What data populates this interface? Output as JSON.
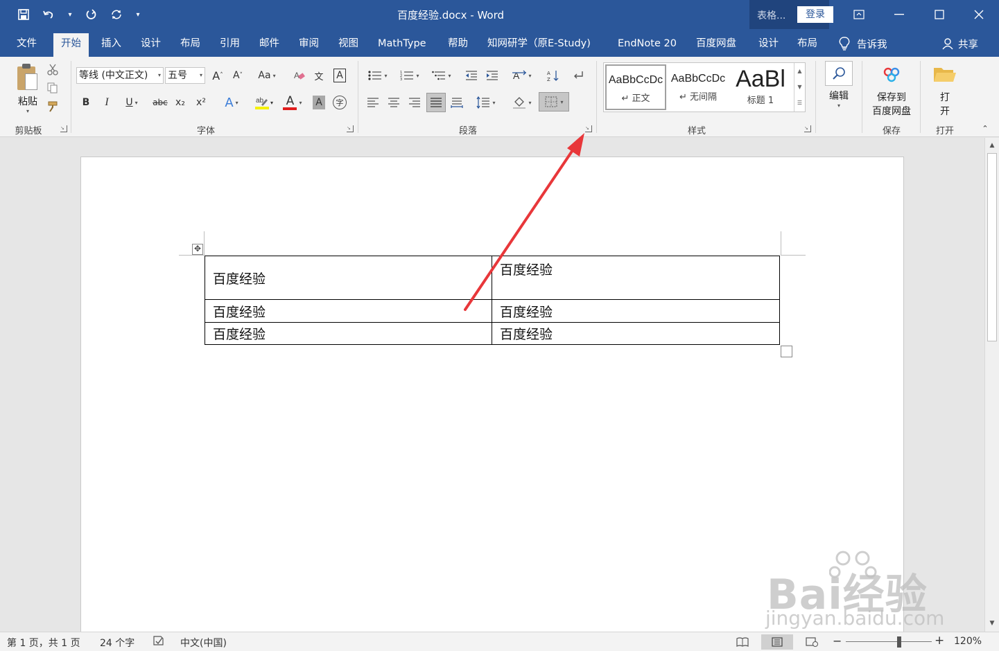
{
  "titlebar": {
    "document_title": "百度经验.docx  -  Word",
    "table_tools_label": "表格...",
    "login_label": "登录",
    "icons": [
      "save-icon",
      "undo-icon",
      "redo-icon",
      "repeat-icon",
      "customize-qat-icon"
    ]
  },
  "tabs": [
    {
      "label": "文件"
    },
    {
      "label": "开始"
    },
    {
      "label": "插入"
    },
    {
      "label": "设计"
    },
    {
      "label": "布局"
    },
    {
      "label": "引用"
    },
    {
      "label": "邮件"
    },
    {
      "label": "审阅"
    },
    {
      "label": "视图"
    },
    {
      "label": "MathType"
    },
    {
      "label": "帮助"
    },
    {
      "label": "知网研学（原E-Study)"
    },
    {
      "label": "EndNote 20"
    },
    {
      "label": "百度网盘"
    },
    {
      "label": "设计"
    },
    {
      "label": "布局"
    }
  ],
  "tellme": {
    "label": "告诉我"
  },
  "share": {
    "label": "共享"
  },
  "ribbon": {
    "clipboard": {
      "paste_label": "粘贴",
      "group_label": "剪贴板"
    },
    "font": {
      "font_name": "等线 (中文正文)",
      "font_size": "五号",
      "group_label": "字体",
      "bold": "B",
      "italic": "I",
      "underline": "U",
      "strikethrough": "abc",
      "subscript": "x₂",
      "superscript": "x²",
      "change_case": "Aa",
      "grow": "A",
      "shrink": "A",
      "text_effects": "A",
      "font_color": "A",
      "char_shading": "A",
      "phonetic": "文",
      "char_border": "A",
      "enclose": "字",
      "font_color_hex": "#e01d1d",
      "highlight_hex": "#f5f100"
    },
    "paragraph": {
      "group_label": "段落"
    },
    "styles": {
      "group_label": "样式",
      "items": [
        {
          "preview": "AaBbCcDc",
          "name": "↵ 正文"
        },
        {
          "preview": "AaBbCcDc",
          "name": "↵ 无间隔"
        },
        {
          "preview": "AaBl",
          "name": "标题 1"
        }
      ]
    },
    "editing": {
      "label": "编辑"
    },
    "save": {
      "line1": "保存到",
      "line2": "百度网盘",
      "group_label": "保存"
    },
    "open": {
      "line1": "打",
      "line2": "开",
      "group_label": "打开"
    }
  },
  "document": {
    "table": [
      [
        "百度经验",
        "百度经验"
      ],
      [
        "百度经验",
        "百度经验"
      ],
      [
        "百度经验",
        "百度经验"
      ]
    ]
  },
  "statusbar": {
    "page_info": "第 1 页，共 1 页",
    "word_count": "24 个字",
    "language": "中文(中国)",
    "zoom_minus": "−",
    "zoom_plus": "+",
    "zoom_level": "120%",
    "zoom_fraction": 0.62
  },
  "watermark": {
    "brand": "Bai经验",
    "url": "jingyan.baidu.com"
  },
  "colors": {
    "ribbon_blue": "#2b579a",
    "annotation_arrow": "#e8373a"
  }
}
